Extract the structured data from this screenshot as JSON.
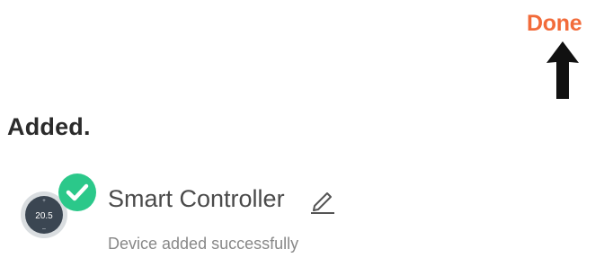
{
  "header": {
    "done_label": "Done",
    "accent_color": "#f26b3a"
  },
  "main": {
    "heading": "Added.",
    "device": {
      "name": "Smart Controller",
      "status": "Device added successfully",
      "display_value": "20.5",
      "icon": "thermostat-icon",
      "badge_icon": "check-circle-icon",
      "badge_color": "#2bc88a",
      "edit_icon": "pencil-icon"
    }
  },
  "annotation": {
    "icon": "arrow-up-icon"
  }
}
